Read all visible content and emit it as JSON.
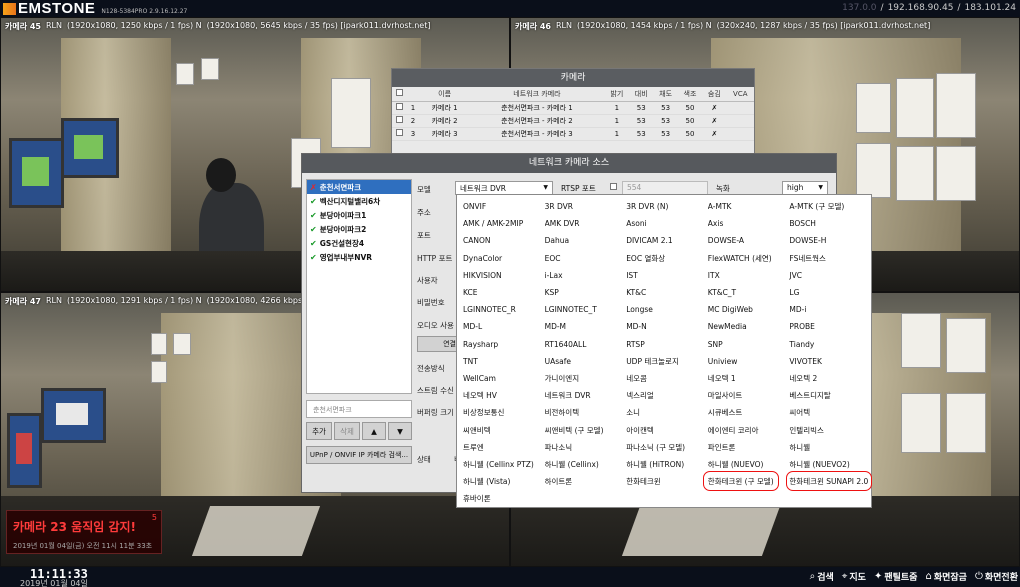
{
  "header": {
    "app_name": "EMSTONE",
    "version": "N128-5384PRO 2.9.16.12.27",
    "ip1": "192.168.90.45",
    "ip2": "183.101.24",
    "sep": "/",
    "dim": "137.0.0"
  },
  "cameras": [
    {
      "name": "카메라 45",
      "rln": "RLN",
      "info": "(1920x1080, 1250 kbps / 1 fps) N",
      "info2": "(1920x1080, 5645 kbps / 35 fps) [ipark011.dvrhost.net]"
    },
    {
      "name": "카메라 46",
      "rln": "RLN",
      "info": "(1920x1080, 1454 kbps / 1 fps) N",
      "info2": "(320x240, 1287 kbps / 35 fps) [ipark011.dvrhost.net]"
    },
    {
      "name": "카메라 47",
      "rln": "RLN",
      "info": "(1920x1080, 1291 kbps / 1 fps) N",
      "info2": "(1920x1080, 4266 kbps / 34 fps) [ipark011.dvrhost.net]"
    }
  ],
  "camlist": {
    "title": "카메라",
    "headers": [
      "이름",
      "네트워크 카메라",
      "밝기",
      "대비",
      "채도",
      "색조",
      "숨김",
      "VCA"
    ],
    "rows": [
      {
        "num": "1",
        "name": "카메라 1",
        "net": "춘천서면파크 - 카메라 1",
        "b": "1",
        "c": "53",
        "s": "53",
        "h": "50",
        "hide": "✗"
      },
      {
        "num": "2",
        "name": "카메라 2",
        "net": "춘천서면파크 - 카메라 2",
        "b": "1",
        "c": "53",
        "s": "53",
        "h": "50",
        "hide": "✗"
      },
      {
        "num": "3",
        "name": "카메라 3",
        "net": "춘천서면파크 - 카메라 3",
        "b": "1",
        "c": "53",
        "s": "53",
        "h": "50",
        "hide": "✗"
      }
    ]
  },
  "netdlg": {
    "title": "네트워크 카메라 소스",
    "sites": [
      {
        "name": "춘천서면파크",
        "status": "x",
        "mark": "✗"
      },
      {
        "name": "벡산디지털밸리6차",
        "status": "ok",
        "mark": "✔"
      },
      {
        "name": "분당아이파크1",
        "status": "ok",
        "mark": "✔"
      },
      {
        "name": "분당아이파크2",
        "status": "ok",
        "mark": "✔"
      },
      {
        "name": "GS건설현장4",
        "status": "ok",
        "mark": "✔"
      },
      {
        "name": "영업부내부NVR",
        "status": "ok",
        "mark": "✔"
      }
    ],
    "site_input": "춘천서면파크",
    "add": "추가",
    "delete": "삭제",
    "up": "▲",
    "down": "▼",
    "upnp": "UPnP / ONVIF IP 카메라 검색...",
    "labels": {
      "model": "모델",
      "addr": "주소",
      "port": "포트",
      "http": "HTTP 포트",
      "user": "사용자",
      "pw": "비밀번호",
      "audio": "오디오 사용",
      "trans": "전송방식",
      "stream": "스트림 수신",
      "buf": "버퍼링 크기",
      "status": "상태"
    },
    "model_value": "네트워크 DVR",
    "rtsp_label": "RTSP 포트",
    "rtsp_value": "554",
    "rec_label": "녹화",
    "rec_value": "high",
    "connect": "연결",
    "status_val": "비"
  },
  "dropdown": [
    "ONVIF",
    "3R DVR",
    "3R DVR (N)",
    "A-MTK",
    "A-MTK (구 모델)",
    "AMK / AMK-2MIP",
    "AMK DVR",
    "Asoni",
    "Axis",
    "BOSCH",
    "CANON",
    "Dahua",
    "DIVICAM 2.1",
    "DOWSE-A",
    "DOWSE-H",
    "DynaColor",
    "EOC",
    "EOC 열화상",
    "FlexWATCH (세연)",
    "FS네트웍스",
    "HIKVISION",
    "i-Lax",
    "IST",
    "ITX",
    "JVC",
    "KCE",
    "KSP",
    "KT&C",
    "KT&C_T",
    "LG",
    "LGINNOTEC_R",
    "LGINNOTEC_T",
    "Longse",
    "MC DigiWeb",
    "MD-i",
    "MD-L",
    "MD-M",
    "MD-N",
    "NewMedia",
    "PROBE",
    "Raysharp",
    "RT1640ALL",
    "RTSP",
    "SNP",
    "Tiandy",
    "TNT",
    "UAsafe",
    "UDP 테크놀로지",
    "Uniview",
    "VIVOTEK",
    "WellCam",
    "가니이엔지",
    "네오콤",
    "네오텍 1",
    "네오텍 2",
    "네오텍 HV",
    "네트워크 DVR",
    "넥스리얼",
    "마일사이트",
    "베스트디지탈",
    "비상정보통신",
    "비전하이텍",
    "소니",
    "시큐베스트",
    "씨어텍",
    "씨앤비텍",
    "씨앤비텍 (구 모델)",
    "아이캔텍",
    "에이엔티 코리아",
    "인텔리빅스",
    "트루엔",
    "파나소닉",
    "파나소닉 (구 모델)",
    "파인트론",
    "하니웰",
    "하니웰 (Cellinx PTZ)",
    "하니웰 (Cellinx)",
    "하니웰 (HiTRON)",
    "하니웰 (NUEVO)",
    "하니웰 (NUEVO2)",
    "하니웰 (Vista)",
    "하이트론",
    "한화테크윈",
    "한화테크윈 (구 모델)",
    "한화테크윈 SUNAPI 2.0",
    "휴바이론"
  ],
  "alarm": {
    "title": "카메라 23 움직임 감지!",
    "date": "2019년 01월 04일(금) 오전 11시 11분 33초",
    "count": "5"
  },
  "footer": {
    "time": "11:11:33",
    "date": "2019년 01월 04일",
    "menu": [
      {
        "icon": "⌕",
        "label": "검색"
      },
      {
        "icon": "⌖",
        "label": "지도"
      },
      {
        "icon": "✦",
        "label": "팬틸트줌"
      },
      {
        "icon": "⌂",
        "label": "화면잠금"
      },
      {
        "icon": "⏻",
        "label": "화면전환"
      }
    ]
  }
}
